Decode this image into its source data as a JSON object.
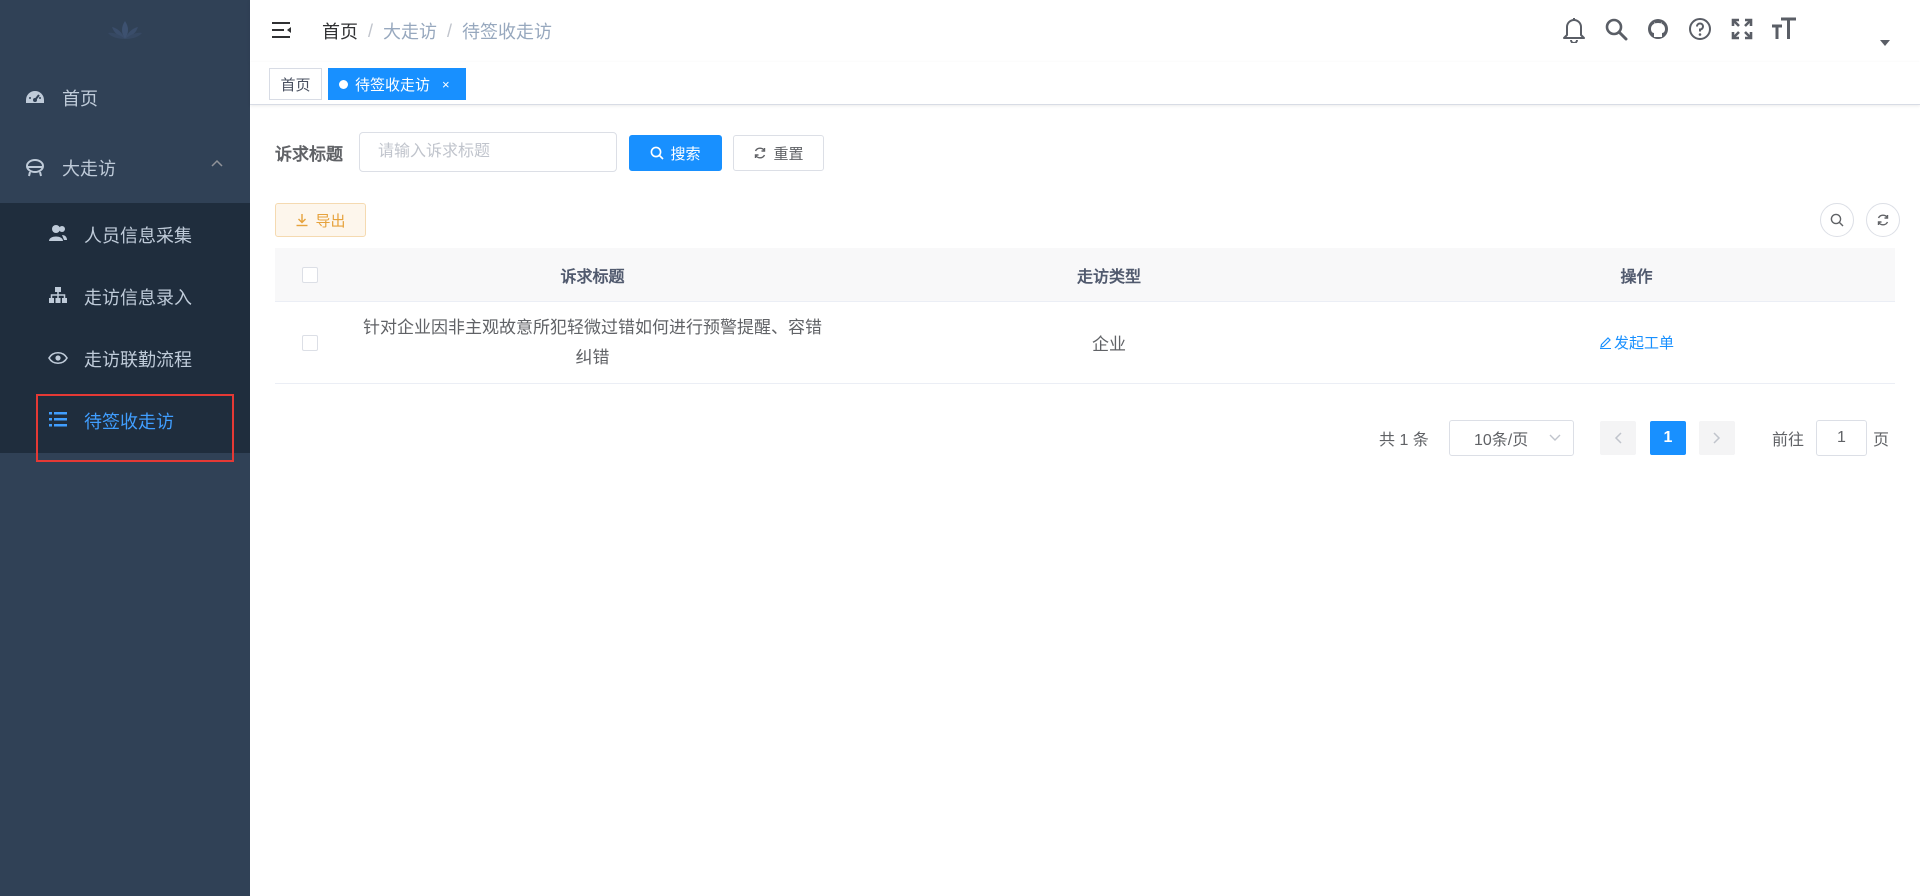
{
  "sidebar": {
    "items": [
      {
        "label": "首页",
        "icon": "dashboard-icon"
      },
      {
        "label": "大走访",
        "icon": "visit-icon",
        "expanded": true
      }
    ],
    "sub_items": [
      {
        "label": "人员信息采集",
        "icon": "peoples-icon"
      },
      {
        "label": "走访信息录入",
        "icon": "tree-icon"
      },
      {
        "label": "走访联勤流程",
        "icon": "eye-icon"
      },
      {
        "label": "待签收走访",
        "icon": "list-icon",
        "active": true
      }
    ],
    "active_color": "#409eff",
    "background": "#304156"
  },
  "breadcrumb": {
    "items": [
      "首页",
      "大走访",
      "待签收走访"
    ],
    "separator": "/"
  },
  "tags": {
    "items": [
      {
        "label": "首页"
      },
      {
        "label": "待签收走访",
        "active": true,
        "close": "×"
      }
    ]
  },
  "search": {
    "label": "诉求标题",
    "placeholder": "请输入诉求标题",
    "value": "",
    "search_label": "搜索",
    "reset_label": "重置"
  },
  "toolbar": {
    "export_label": "导出"
  },
  "table": {
    "columns": [
      "诉求标题",
      "走访类型",
      "操作"
    ],
    "rows": [
      {
        "title": "针对企业因非主观故意所犯轻微过错如何进行预警提醒、容错纠错",
        "type": "企业",
        "action": "发起工单"
      }
    ]
  },
  "pagination": {
    "total_text": "共 1 条",
    "page_size": "10条/页",
    "current_page": "1",
    "goto_label": "前往",
    "goto_value": "1",
    "page_suffix": "页"
  },
  "colors": {
    "primary": "#1890ff",
    "warning": "#e6a23c"
  }
}
